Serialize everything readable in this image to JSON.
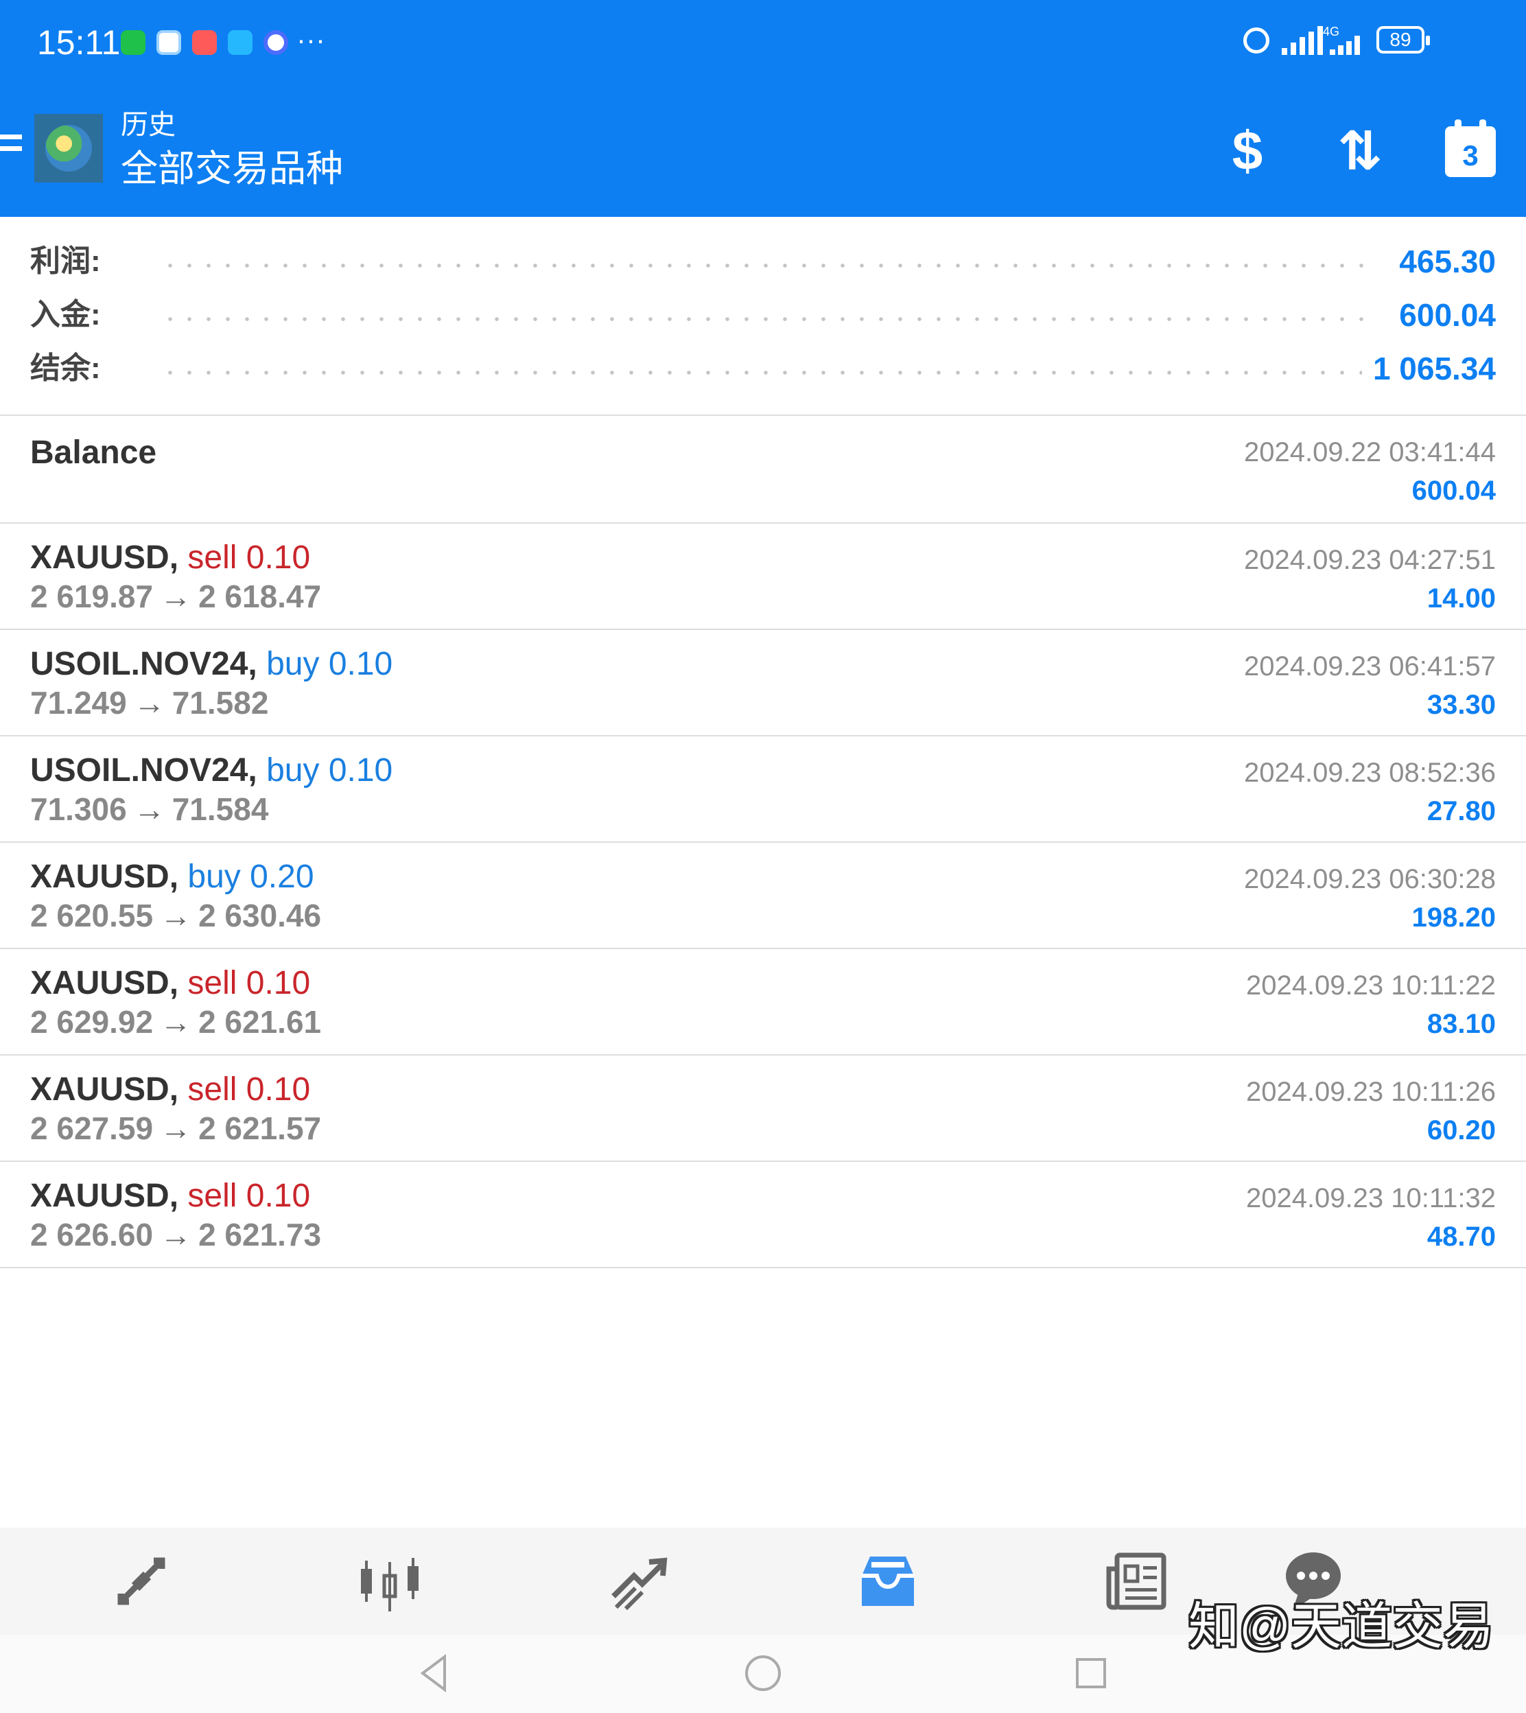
{
  "status_bar": {
    "time": "15:11",
    "more": "···",
    "network": "4G",
    "battery": "89",
    "icons": [
      "wechat-icon",
      "message-icon",
      "red-app-icon",
      "chat-icon",
      "circle-app-icon",
      "alarm-icon",
      "signal-icon",
      "battery-icon"
    ]
  },
  "header": {
    "subtitle": "历史",
    "title": "全部交易品种",
    "calendar_badge": "3",
    "accent_color": "#0d7ff2"
  },
  "summary": [
    {
      "label": "利润:",
      "value": "465.30"
    },
    {
      "label": "入金:",
      "value": "600.04"
    },
    {
      "label": "结余:",
      "value": "1 065.34"
    }
  ],
  "balance": {
    "label": "Balance",
    "time": "2024.09.22 03:41:44",
    "amount": "600.04"
  },
  "deals": [
    {
      "symbol": "XAUUSD,",
      "side": "sell",
      "volume": "0.10",
      "open": "2 619.87",
      "close": "2 618.47",
      "time": "2024.09.23 04:27:51",
      "profit": "14.00"
    },
    {
      "symbol": "USOIL.NOV24,",
      "side": "buy",
      "volume": "0.10",
      "open": "71.249",
      "close": "71.582",
      "time": "2024.09.23 06:41:57",
      "profit": "33.30"
    },
    {
      "symbol": "USOIL.NOV24,",
      "side": "buy",
      "volume": "0.10",
      "open": "71.306",
      "close": "71.584",
      "time": "2024.09.23 08:52:36",
      "profit": "27.80"
    },
    {
      "symbol": "XAUUSD,",
      "side": "buy",
      "volume": "0.20",
      "open": "2 620.55",
      "close": "2 630.46",
      "time": "2024.09.23 06:30:28",
      "profit": "198.20"
    },
    {
      "symbol": "XAUUSD,",
      "side": "sell",
      "volume": "0.10",
      "open": "2 629.92",
      "close": "2 621.61",
      "time": "2024.09.23 10:11:22",
      "profit": "83.10"
    },
    {
      "symbol": "XAUUSD,",
      "side": "sell",
      "volume": "0.10",
      "open": "2 627.59",
      "close": "2 621.57",
      "time": "2024.09.23 10:11:26",
      "profit": "60.20"
    },
    {
      "symbol": "XAUUSD,",
      "side": "sell",
      "volume": "0.10",
      "open": "2 626.60",
      "close": "2 621.73",
      "time": "2024.09.23 10:11:32",
      "profit": "48.70"
    }
  ],
  "colors": {
    "sell": "#c9252b",
    "buy": "#1a7fe0",
    "profit": "#0d7ff2",
    "active_tab": "#3d93f0"
  },
  "bottom_nav": [
    {
      "icon": "quotes-icon",
      "active": false
    },
    {
      "icon": "chart-icon",
      "active": false
    },
    {
      "icon": "trade-icon",
      "active": false
    },
    {
      "icon": "history-icon",
      "active": true
    },
    {
      "icon": "news-icon",
      "active": false
    },
    {
      "icon": "messages-icon",
      "active": false
    }
  ],
  "watermark": "知@天道交易"
}
